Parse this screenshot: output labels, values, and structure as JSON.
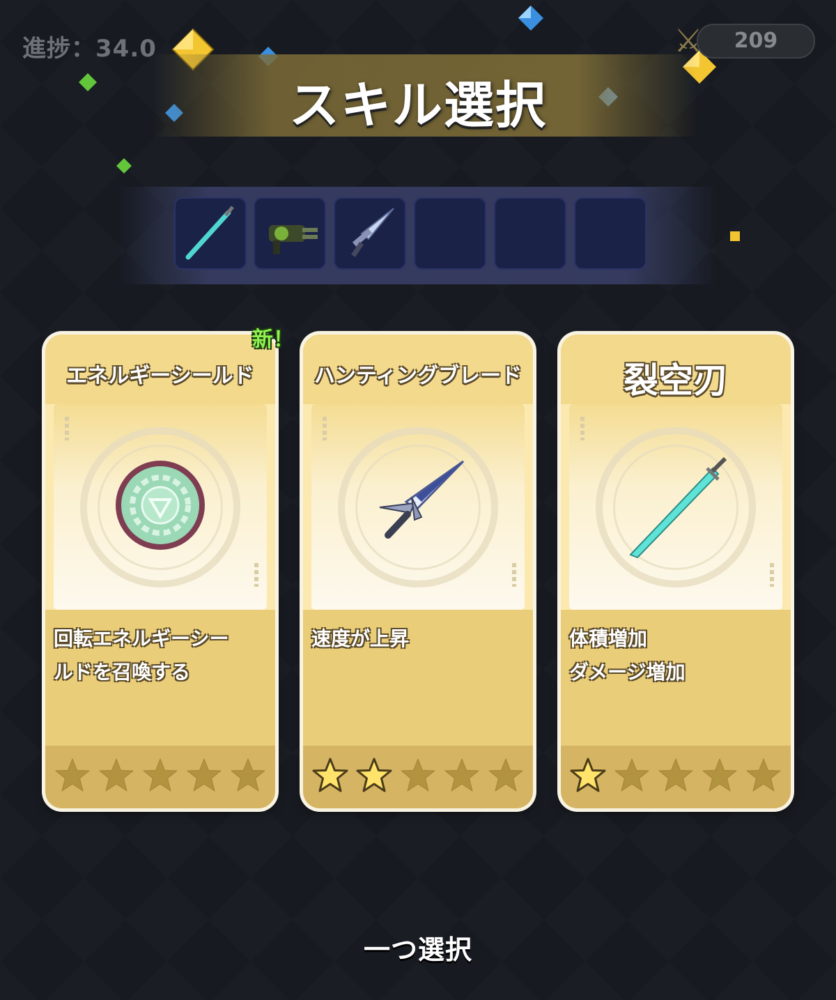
{
  "hud": {
    "progress_label": "進捗：34.0",
    "kill_count": "209",
    "kill_icon": "crossed-swords-icon"
  },
  "title": "スキル選択",
  "skill_slots": [
    {
      "icon": "cyan-sword-icon",
      "filled": true
    },
    {
      "icon": "gatling-gun-icon",
      "filled": true
    },
    {
      "icon": "hunting-blade-icon",
      "filled": true
    },
    {
      "icon": "",
      "filled": false
    },
    {
      "icon": "",
      "filled": false
    },
    {
      "icon": "",
      "filled": false
    }
  ],
  "new_badge": "新！",
  "cards": [
    {
      "name": "エネルギーシールド",
      "icon": "energy-shield-icon",
      "description_lines": [
        "回転エネルギーシー",
        "ルドを召喚する"
      ],
      "stars_filled": 0,
      "stars_total": 5,
      "is_new": true
    },
    {
      "name": "ハンティングブレード",
      "icon": "hunting-blade-icon",
      "description_lines": [
        "速度が上昇"
      ],
      "stars_filled": 2,
      "stars_total": 5,
      "is_new": false
    },
    {
      "name": "裂空刃",
      "icon": "cyan-sword-icon",
      "description_lines": [
        "体積増加",
        "ダメージ増加"
      ],
      "stars_filled": 1,
      "stars_total": 5,
      "is_new": false
    }
  ],
  "footer": "一つ選択",
  "colors": {
    "card_bg": "#fbe9b0",
    "star_filled": "#ffe36a",
    "star_empty": "#b2933f",
    "new_badge": "#8ef24e"
  }
}
